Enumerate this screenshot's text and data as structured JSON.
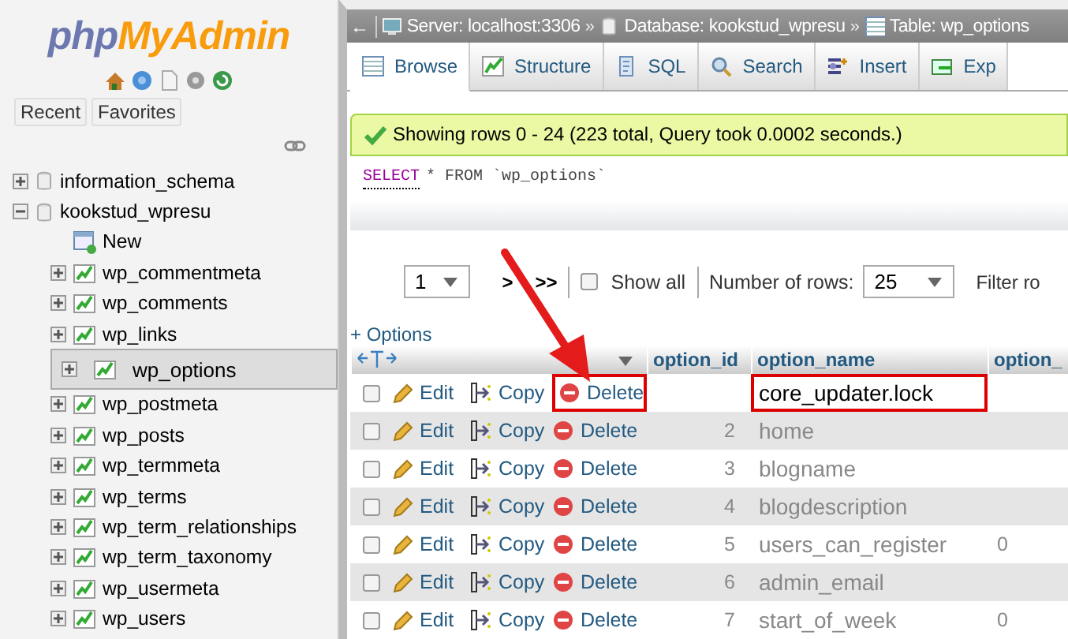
{
  "logo": {
    "php": "php",
    "myadmin": "MyAdmin"
  },
  "sidebar_buttons": [
    "Recent",
    "Favorites"
  ],
  "tree": [
    {
      "name": "information_schema",
      "expanded": false
    },
    {
      "name": "kookstud_wpresu",
      "expanded": true,
      "children": [
        {
          "kind": "new",
          "name": "New",
          "selected": false
        },
        {
          "kind": "table",
          "name": "wp_commentmeta",
          "selected": false
        },
        {
          "kind": "table",
          "name": "wp_comments",
          "selected": false
        },
        {
          "kind": "table",
          "name": "wp_links",
          "selected": false
        },
        {
          "kind": "table",
          "name": "wp_options",
          "selected": true
        },
        {
          "kind": "table",
          "name": "wp_postmeta",
          "selected": false
        },
        {
          "kind": "table",
          "name": "wp_posts",
          "selected": false
        },
        {
          "kind": "table",
          "name": "wp_termmeta",
          "selected": false
        },
        {
          "kind": "table",
          "name": "wp_terms",
          "selected": false
        },
        {
          "kind": "table",
          "name": "wp_term_relationships",
          "selected": false
        },
        {
          "kind": "table",
          "name": "wp_term_taxonomy",
          "selected": false
        },
        {
          "kind": "table",
          "name": "wp_usermeta",
          "selected": false
        },
        {
          "kind": "table",
          "name": "wp_users",
          "selected": false
        }
      ]
    }
  ],
  "back": "←",
  "breadcrumb": [
    {
      "kind": "server",
      "label": "Server: localhost:3306",
      "separator": "»"
    },
    {
      "kind": "database",
      "label": "Database: kookstud_wpresu",
      "separator": "»"
    },
    {
      "kind": "table",
      "label": "Table: wp_options"
    }
  ],
  "tabs": [
    {
      "kind": "browse",
      "label": "Browse",
      "selected": true
    },
    {
      "kind": "structure",
      "label": "Structure",
      "selected": false
    },
    {
      "kind": "sql",
      "label": "SQL",
      "selected": false
    },
    {
      "kind": "search",
      "label": "Search",
      "selected": false
    },
    {
      "kind": "insert",
      "label": "Insert",
      "selected": false
    },
    {
      "kind": "export",
      "label": "Exp",
      "selected": false
    }
  ],
  "message": "Showing rows 0 - 24 (223 total, Query took 0.0002 seconds.)",
  "sql": {
    "keyword": "SELECT",
    "rest": "* FROM `wp_options`"
  },
  "pager": {
    "page": "1",
    "next": ">",
    "last": ">>",
    "show_all": {
      "label": "Show all",
      "checked": false
    },
    "rows_label": "Number of rows:",
    "rows_value": "25",
    "filter_label": "Filter ro"
  },
  "options_link": "+ Options",
  "columns": [
    "option_id",
    "option_name",
    "option_"
  ],
  "rows": [
    {
      "checked": false,
      "edit": "Edit",
      "copy": "Copy",
      "delete": "Delete",
      "option_name": "core_updater.lock",
      "highlighted": true,
      "blurred": false
    },
    {
      "checked": false,
      "edit": "Edit",
      "copy": "Copy",
      "delete": "Delete",
      "option_id": "2",
      "option_name": "home",
      "highlighted": false,
      "blurred": true
    },
    {
      "checked": false,
      "edit": "Edit",
      "copy": "Copy",
      "delete": "Delete",
      "option_id": "3",
      "option_name": "blogname",
      "highlighted": false,
      "blurred": true
    },
    {
      "checked": false,
      "edit": "Edit",
      "copy": "Copy",
      "delete": "Delete",
      "option_id": "4",
      "option_name": "blogdescription",
      "highlighted": false,
      "blurred": true
    },
    {
      "checked": false,
      "edit": "Edit",
      "copy": "Copy",
      "delete": "Delete",
      "option_id": "5",
      "option_name": "users_can_register",
      "option_value": "0",
      "highlighted": false,
      "blurred": true
    },
    {
      "checked": false,
      "edit": "Edit",
      "copy": "Copy",
      "delete": "Delete",
      "option_id": "6",
      "option_name": "admin_email",
      "highlighted": false,
      "blurred": true
    },
    {
      "checked": false,
      "edit": "Edit",
      "copy": "Copy",
      "delete": "Delete",
      "option_id": "7",
      "option_name": "start_of_week",
      "option_value": "0",
      "highlighted": false,
      "blurred": true
    }
  ],
  "annotation": {
    "arrow": true
  }
}
